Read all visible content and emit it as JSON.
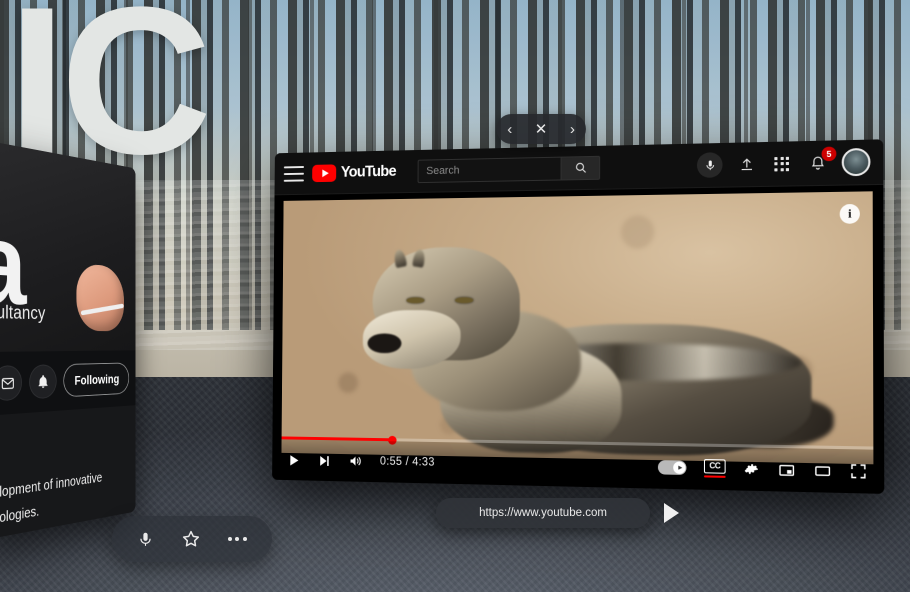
{
  "environment": {
    "backdrop_text": "IC",
    "scene": "forest-mural-backdrop",
    "floor_color": "#4a5059"
  },
  "window_controls": {
    "back_label": "‹",
    "close_label": "✕",
    "forward_label": "›"
  },
  "left_panel": {
    "big_letter": "a",
    "headline_fragment": "nsultancy",
    "body_text_line1": "elopment of innovative",
    "body_text_line2": "nologies.",
    "follow_label": "Following",
    "mail_icon": "mail-icon",
    "bell_icon": "bell-icon"
  },
  "youtube": {
    "brand": "YouTube",
    "menu_icon": "hamburger-menu-icon",
    "search": {
      "value": "",
      "placeholder": "Search",
      "submit_icon": "search-icon"
    },
    "header_actions": {
      "voice_search_icon": "microphone-icon",
      "upload_icon": "upload-icon",
      "apps_icon": "apps-grid-icon",
      "notifications_icon": "bell-icon",
      "notifications_count": "5",
      "avatar_icon": "avatar"
    },
    "player": {
      "info_badge": "i",
      "play_icon": "play-icon",
      "next_icon": "next-track-icon",
      "volume_icon": "volume-icon",
      "current_time": "0:55",
      "total_time": "4:33",
      "time_display": "0:55 / 4:33",
      "progress_percent": 20,
      "autoplay_label": "autoplay-toggle",
      "autoplay_on": true,
      "captions_label": "CC",
      "captions_active": true,
      "settings_icon": "gear-icon",
      "miniplayer_icon": "miniplayer-icon",
      "theater_icon": "theater-mode-icon",
      "fullscreen_icon": "fullscreen-icon",
      "progress_color": "#ff0000"
    }
  },
  "url_bar": {
    "url": "https://www.youtube.com",
    "go_icon": "play-arrow-icon"
  },
  "dock": {
    "mic_icon": "microphone-icon",
    "favorite_icon": "star-icon",
    "more_icon": "more-options-icon"
  }
}
